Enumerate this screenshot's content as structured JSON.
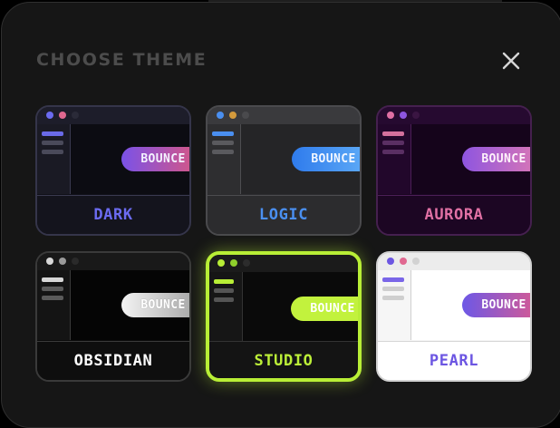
{
  "dialog": {
    "title": "CHOOSE THEME",
    "close_icon": "close-icon"
  },
  "themes": [
    {
      "id": "dark",
      "label": "DARK",
      "button": "BOUNCE",
      "dots": [
        "#6b6bf0",
        "#e06890",
        "#2a2a38"
      ],
      "lines": [
        "#6a6ae8",
        "#4a4a5a",
        "#4a4a5a"
      ]
    },
    {
      "id": "logic",
      "label": "LOGIC",
      "button": "BOUNCE",
      "dots": [
        "#4a8ff0",
        "#d39a3c",
        "#4a4a4d"
      ],
      "lines": [
        "#4a8ff0",
        "#5a5a5e",
        "#5a5a5e"
      ]
    },
    {
      "id": "aurora",
      "label": "AURORA",
      "button": "BOUNCE",
      "dots": [
        "#e070a4",
        "#8e55e0",
        "#3a1542"
      ],
      "lines": [
        "#d4709d",
        "#5a2f63",
        "#5a2f63"
      ]
    },
    {
      "id": "obsidian",
      "label": "OBSIDIAN",
      "button": "BOUNCE",
      "dots": [
        "#d8d8d8",
        "#9a9a9a",
        "#2a2a2a"
      ],
      "lines": [
        "#d6d6d6",
        "#5a5a5a",
        "#5a5a5a"
      ]
    },
    {
      "id": "studio",
      "label": "STUDIO",
      "button": "BOUNCE",
      "dots": [
        "#b8ee36",
        "#8fcf2c",
        "#2c2c2c"
      ],
      "lines": [
        "#b8ee36",
        "#555555",
        "#555555"
      ]
    },
    {
      "id": "pearl",
      "label": "PEARL",
      "button": "BOUNCE",
      "dots": [
        "#6c56e2",
        "#e06890",
        "#d2d2d2"
      ],
      "lines": [
        "#7a66e8",
        "#cfcfcf",
        "#cfcfcf"
      ]
    }
  ],
  "selected_theme": "STUDIO"
}
